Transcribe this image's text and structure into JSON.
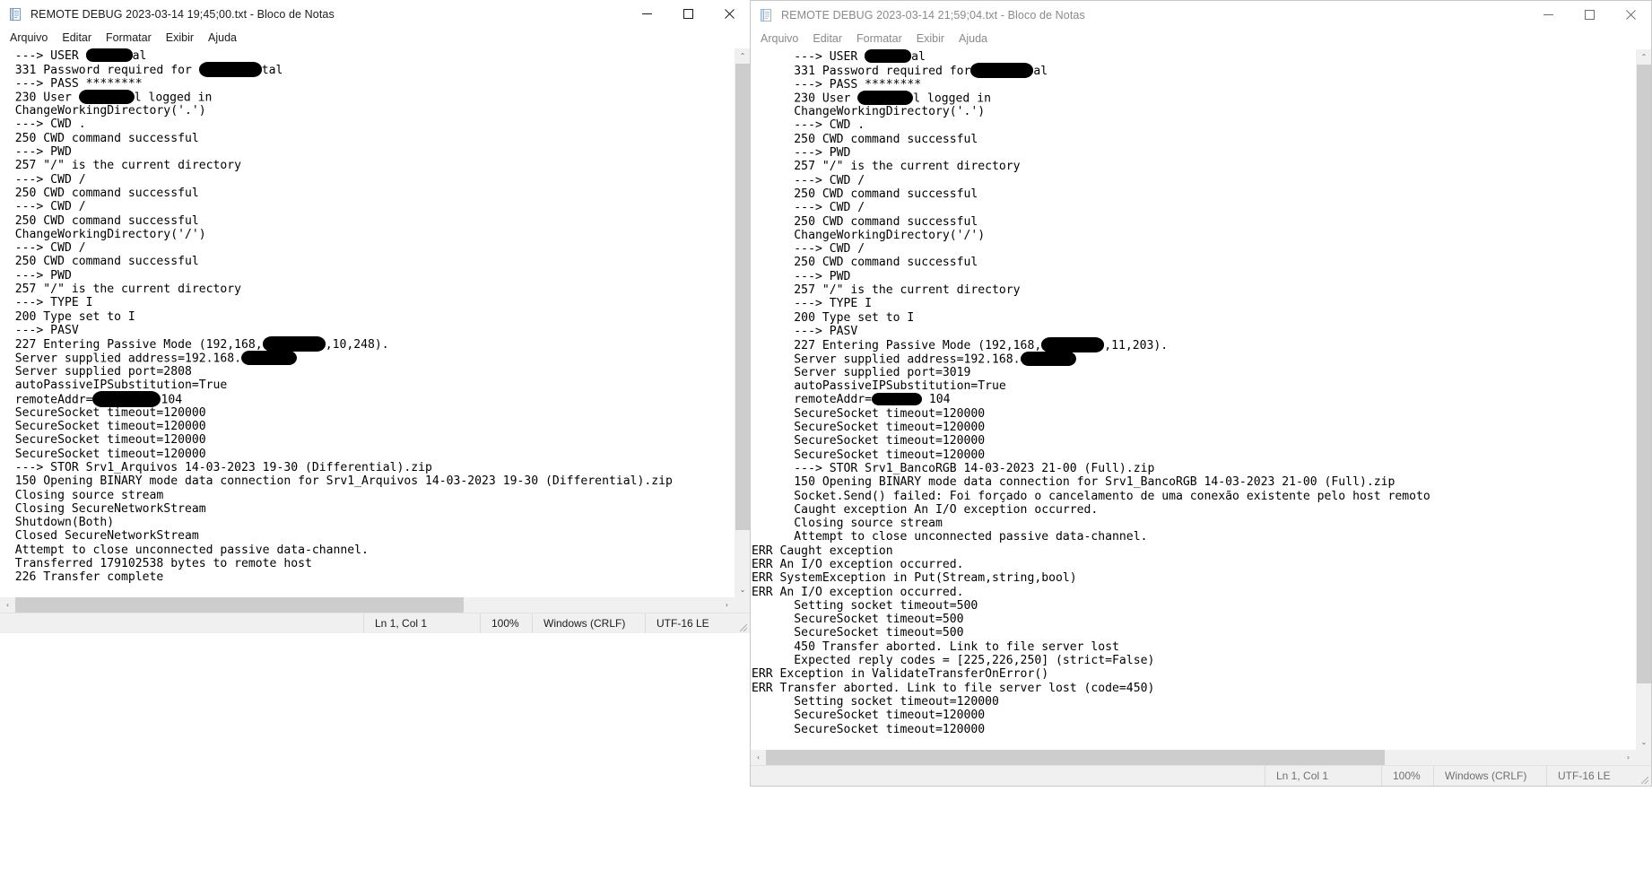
{
  "windows": [
    {
      "id": "left",
      "title": "REMOTE DEBUG 2023-03-14 19;45;00.txt - Bloco de Notas",
      "icon": "notepad-icon",
      "active": true,
      "menu": [
        "Arquivo",
        "Editar",
        "Formatar",
        "Exibir",
        "Ajuda"
      ],
      "caption": {
        "minimize": "─",
        "maximize": "☐",
        "close": "✕"
      },
      "status": {
        "position": "Ln 1, Col 1",
        "zoom": "100%",
        "line_ending": "Windows (CRLF)",
        "encoding": "UTF-16 LE"
      },
      "lines": [
        {
          "text": "  ---> USER ",
          "redact": "r-a",
          "after": "al"
        },
        {
          "text": "  331 Password required for ",
          "redact": "r-b",
          "after": "tal"
        },
        {
          "text": "  ---> PASS ********"
        },
        {
          "text": "  230 User ",
          "redact": "r-c",
          "after": "l logged in"
        },
        {
          "text": "  ChangeWorkingDirectory('.')"
        },
        {
          "text": "  ---> CWD ."
        },
        {
          "text": "  250 CWD command successful"
        },
        {
          "text": "  ---> PWD"
        },
        {
          "text": "  257 \"/\" is the current directory"
        },
        {
          "text": "  ---> CWD /"
        },
        {
          "text": "  250 CWD command successful"
        },
        {
          "text": "  ---> CWD /"
        },
        {
          "text": "  250 CWD command successful"
        },
        {
          "text": "  ChangeWorkingDirectory('/')"
        },
        {
          "text": "  ---> CWD /"
        },
        {
          "text": "  250 CWD command successful"
        },
        {
          "text": "  ---> PWD"
        },
        {
          "text": "  257 \"/\" is the current directory"
        },
        {
          "text": "  ---> TYPE I"
        },
        {
          "text": "  200 Type set to I"
        },
        {
          "text": "  ---> PASV"
        },
        {
          "text": "  227 Entering Passive Mode (192,168,",
          "redact": "r-b",
          "after": ",10,248)."
        },
        {
          "text": "  Server supplied address=192.168.",
          "redact": "r-c",
          "after": ""
        },
        {
          "text": "  Server supplied port=2808"
        },
        {
          "text": "  autoPassiveIPSubstitution=True"
        },
        {
          "text": "  remoteAddr=",
          "redact": "r-e",
          "after": "104"
        },
        {
          "text": "  SecureSocket timeout=120000"
        },
        {
          "text": "  SecureSocket timeout=120000"
        },
        {
          "text": "  SecureSocket timeout=120000"
        },
        {
          "text": "  SecureSocket timeout=120000"
        },
        {
          "text": "  ---> STOR Srv1_Arquivos 14-03-2023 19-30 (Differential).zip"
        },
        {
          "text": "  150 Opening BINARY mode data connection for Srv1_Arquivos 14-03-2023 19-30 (Differential).zip"
        },
        {
          "text": "  Closing source stream"
        },
        {
          "text": "  Closing SecureNetworkStream"
        },
        {
          "text": "  Shutdown(Both)"
        },
        {
          "text": "  Closed SecureNetworkStream"
        },
        {
          "text": "  Attempt to close unconnected passive data-channel."
        },
        {
          "text": "  Transferred 179102538 bytes to remote host"
        },
        {
          "text": "  226 Transfer complete"
        }
      ]
    },
    {
      "id": "right",
      "title": "REMOTE DEBUG 2023-03-14 21;59;04.txt - Bloco de Notas",
      "icon": "notepad-icon",
      "active": false,
      "menu": [
        "Arquivo",
        "Editar",
        "Formatar",
        "Exibir",
        "Ajuda"
      ],
      "caption": {
        "minimize": "─",
        "maximize": "☐",
        "close": "✕"
      },
      "status": {
        "position": "Ln 1, Col 1",
        "zoom": "100%",
        "line_ending": "Windows (CRLF)",
        "encoding": "UTF-16 LE"
      },
      "lines": [
        {
          "text": "      ---> USER ",
          "redact": "r-a",
          "after": "al"
        },
        {
          "text": "      331 Password required for",
          "redact": "r-b",
          "after": "al"
        },
        {
          "text": "      ---> PASS ********"
        },
        {
          "text": "      230 User ",
          "redact": "r-c",
          "after": "l logged in"
        },
        {
          "text": "      ChangeWorkingDirectory('.')"
        },
        {
          "text": "      ---> CWD ."
        },
        {
          "text": "      250 CWD command successful"
        },
        {
          "text": "      ---> PWD"
        },
        {
          "text": "      257 \"/\" is the current directory"
        },
        {
          "text": "      ---> CWD /"
        },
        {
          "text": "      250 CWD command successful"
        },
        {
          "text": "      ---> CWD /"
        },
        {
          "text": "      250 CWD command successful"
        },
        {
          "text": "      ChangeWorkingDirectory('/')"
        },
        {
          "text": "      ---> CWD /"
        },
        {
          "text": "      250 CWD command successful"
        },
        {
          "text": "      ---> PWD"
        },
        {
          "text": "      257 \"/\" is the current directory"
        },
        {
          "text": "      ---> TYPE I"
        },
        {
          "text": "      200 Type set to I"
        },
        {
          "text": "      ---> PASV"
        },
        {
          "text": "      227 Entering Passive Mode (192,168,",
          "redact": "r-b",
          "after": ",11,203)."
        },
        {
          "text": "      Server supplied address=192.168.",
          "redact": "r-c",
          "after": ""
        },
        {
          "text": "      Server supplied port=3019"
        },
        {
          "text": "      autoPassiveIPSubstitution=True"
        },
        {
          "text": "      remoteAddr=",
          "redact": "r-d",
          "after": " 104"
        },
        {
          "text": "      SecureSocket timeout=120000"
        },
        {
          "text": "      SecureSocket timeout=120000"
        },
        {
          "text": "      SecureSocket timeout=120000"
        },
        {
          "text": "      SecureSocket timeout=120000"
        },
        {
          "text": "      ---> STOR Srv1_BancoRGB 14-03-2023 21-00 (Full).zip"
        },
        {
          "text": "      150 Opening BINARY mode data connection for Srv1_BancoRGB 14-03-2023 21-00 (Full).zip"
        },
        {
          "text": "      Socket.Send() failed: Foi forçado o cancelamento de uma conexão existente pelo host remoto"
        },
        {
          "text": "      Caught exception An I/O exception occurred."
        },
        {
          "text": "      Closing source stream"
        },
        {
          "text": "      Attempt to close unconnected passive data-channel."
        },
        {
          "text": "ERR Caught exception"
        },
        {
          "text": "ERR An I/O exception occurred."
        },
        {
          "text": "ERR SystemException in Put(Stream,string,bool)"
        },
        {
          "text": "ERR An I/O exception occurred."
        },
        {
          "text": "      Setting socket timeout=500"
        },
        {
          "text": "      SecureSocket timeout=500"
        },
        {
          "text": "      SecureSocket timeout=500"
        },
        {
          "text": "      450 Transfer aborted. Link to file server lost"
        },
        {
          "text": "      Expected reply codes = [225,226,250] (strict=False)"
        },
        {
          "text": "ERR Exception in ValidateTransferOnError()"
        },
        {
          "text": "ERR Transfer aborted. Link to file server lost (code=450)"
        },
        {
          "text": "      Setting socket timeout=120000"
        },
        {
          "text": "      SecureSocket timeout=120000"
        },
        {
          "text": "      SecureSocket timeout=120000"
        }
      ]
    }
  ],
  "scrollbar": {
    "up_arrow": "⌃",
    "down_arrow": "⌄",
    "left_arrow": "‹",
    "right_arrow": "›"
  }
}
